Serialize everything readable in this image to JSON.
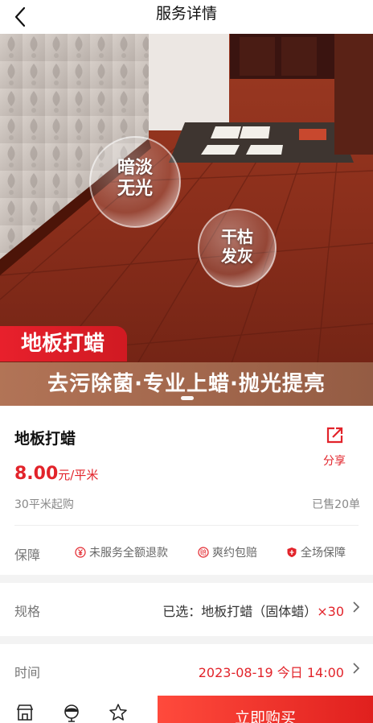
{
  "header": {
    "title": "服务详情",
    "back_icon": "chevron-left-icon"
  },
  "hero": {
    "bubble_1": [
      "暗淡",
      "无光"
    ],
    "bubble_2": [
      "干枯",
      "发灰"
    ],
    "tag": "地板打蜡",
    "slogan": "去污除菌·专业上蜡·抛光提亮"
  },
  "product": {
    "name": "地板打蜡",
    "share_label": "分享",
    "price": "8.00",
    "price_unit": "元/平米",
    "min_purchase": "30平米起购",
    "sold": "已售20单"
  },
  "guarantee": {
    "label": "保障",
    "items": [
      "未服务全额退款",
      "爽约包赔",
      "全场保障"
    ]
  },
  "spec": {
    "label": "规格",
    "value": "已选：地板打蜡（固体蜡）",
    "qty": "×30"
  },
  "time": {
    "label": "时间",
    "value": "2023-08-19 今日 14:00"
  },
  "bottom": {
    "buy_label": "立即购买"
  },
  "colors": {
    "accent": "#e2232a"
  }
}
